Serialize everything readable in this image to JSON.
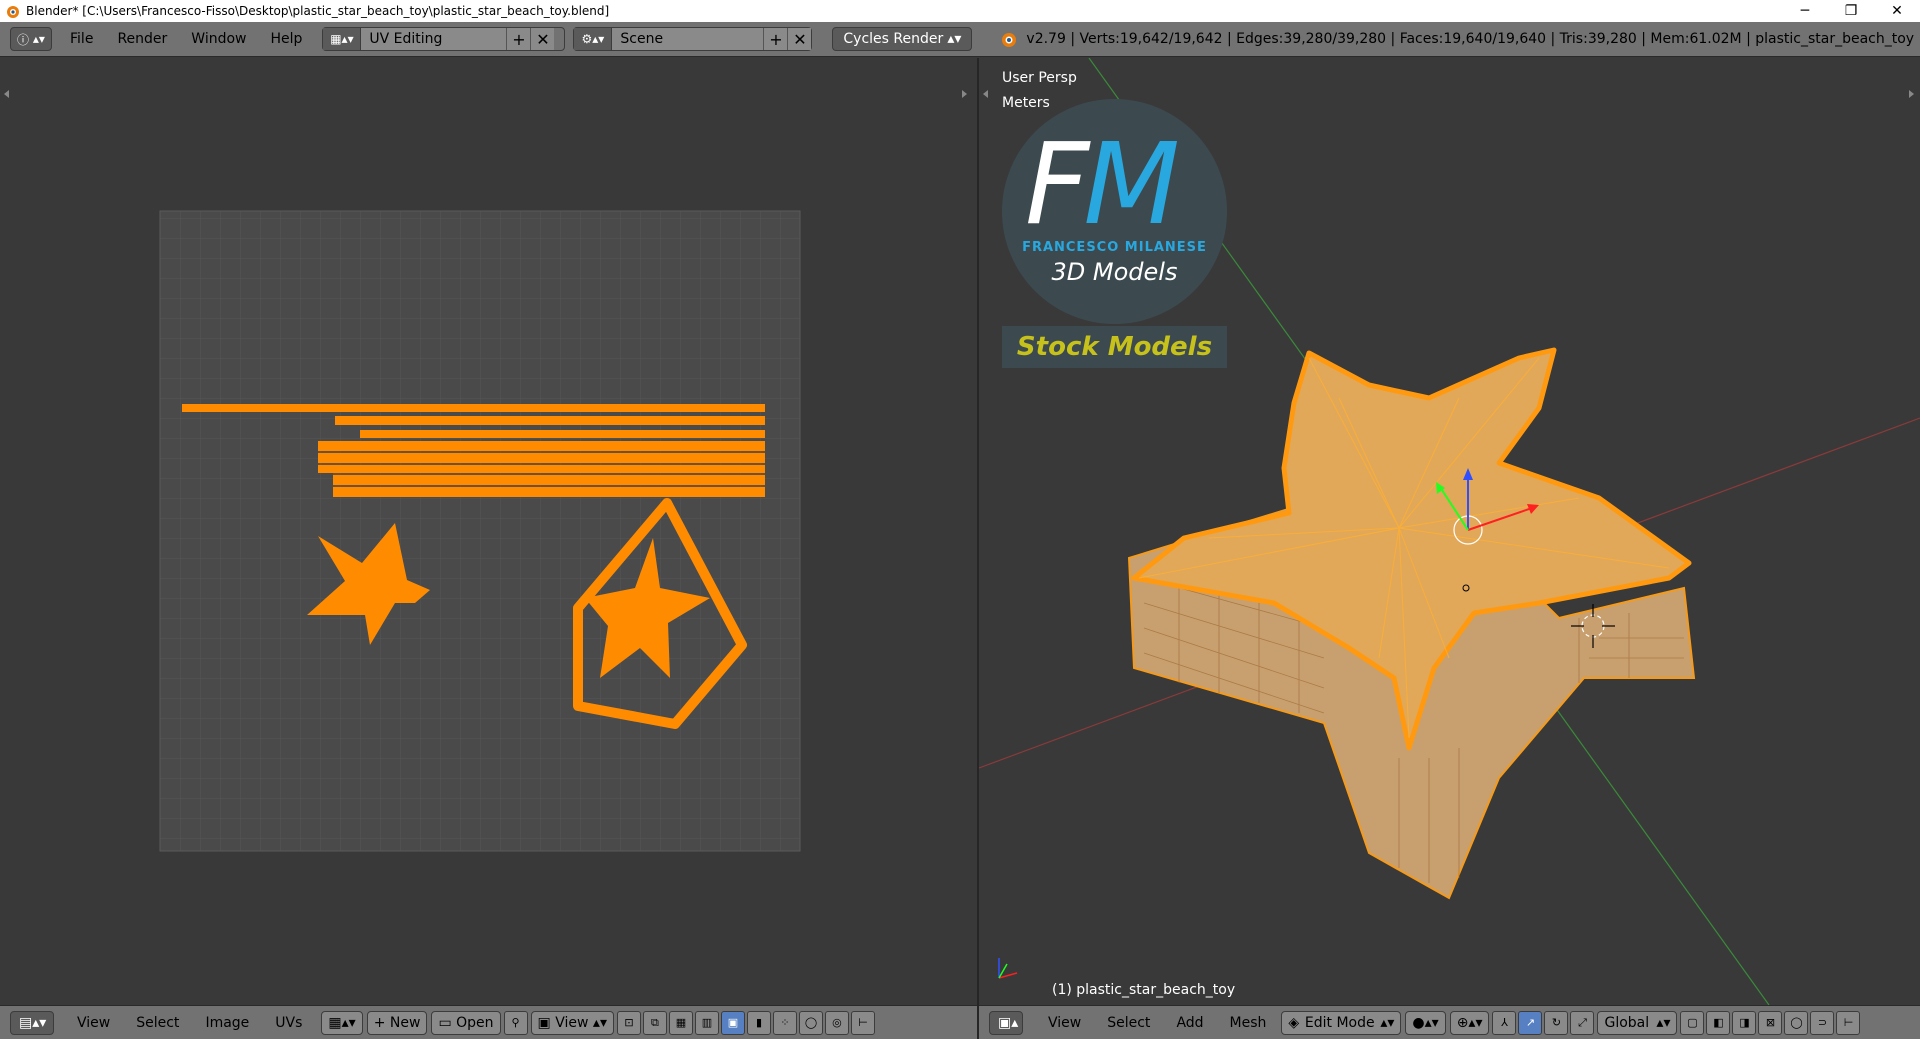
{
  "window": {
    "title": "Blender* [C:\\Users\\Francesco-Fisso\\Desktop\\plastic_star_beach_toy\\plastic_star_beach_toy.blend]",
    "minimize": "─",
    "restore": "❐",
    "close": "✕"
  },
  "info_header": {
    "editor_icon": "ⓘ",
    "menus": [
      "File",
      "Render",
      "Window",
      "Help"
    ],
    "screen_layout": "UV Editing",
    "scene": "Scene",
    "render_engine": "Cycles Render",
    "stats": "v2.79 | Verts:19,642/19,642 | Edges:39,280/39,280 | Faces:19,640/19,640 | Tris:39,280 | Mem:61.02M | plastic_star_beach_toy"
  },
  "uv_editor": {
    "footer": {
      "menus": [
        "View",
        "Select",
        "Image",
        "UVs"
      ],
      "new_label": "New",
      "open_label": "Open",
      "view_label": "View"
    }
  },
  "viewport": {
    "view_name": "User Persp",
    "units": "Meters",
    "object_label": "(1) plastic_star_beach_toy",
    "logo": {
      "initial_f": "F",
      "initial_m": "M",
      "name": "FRANCESCO MILANESE",
      "subtitle": "3D Models",
      "badge": "Stock Models"
    },
    "footer": {
      "menus": [
        "View",
        "Select",
        "Add",
        "Mesh"
      ],
      "mode": "Edit Mode",
      "orientation": "Global"
    }
  },
  "colors": {
    "uv_orange": "#ff8c00",
    "mesh_orange": "#f59a1a",
    "grid_bg": "#4a4a4a",
    "accent_blue": "#29a8df",
    "badge_yellow": "#c7c21b"
  }
}
